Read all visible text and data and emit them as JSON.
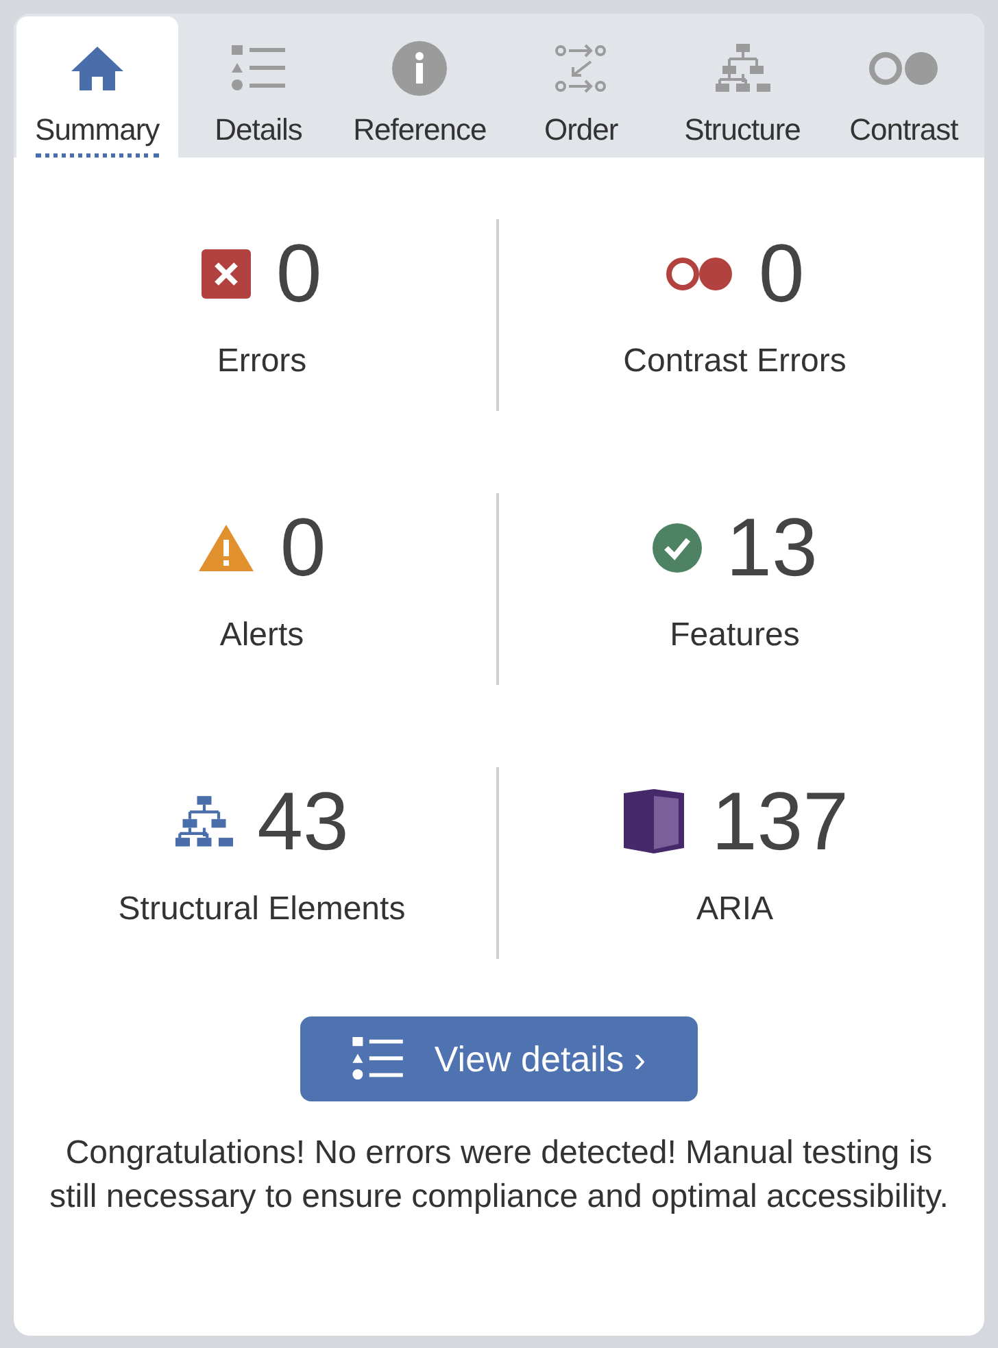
{
  "tabs": [
    {
      "label": "Summary",
      "kind": "home",
      "selected": true
    },
    {
      "label": "Details",
      "kind": "list",
      "selected": false
    },
    {
      "label": "Reference",
      "kind": "info",
      "selected": false
    },
    {
      "label": "Order",
      "kind": "order",
      "selected": false
    },
    {
      "label": "Structure",
      "kind": "tree",
      "selected": false
    },
    {
      "label": "Contrast",
      "kind": "contrast",
      "selected": false
    }
  ],
  "stats": [
    {
      "kind": "errors",
      "count": "0",
      "label": "Errors"
    },
    {
      "kind": "contrast",
      "count": "0",
      "label": "Contrast Errors"
    },
    {
      "kind": "alerts",
      "count": "0",
      "label": "Alerts"
    },
    {
      "kind": "features",
      "count": "13",
      "label": "Features"
    },
    {
      "kind": "structure",
      "count": "43",
      "label": "Structural Elements"
    },
    {
      "kind": "aria",
      "count": "137",
      "label": "ARIA"
    }
  ],
  "button": "View details ›",
  "message": "Congratulations! No errors were detected! Manual testing is still necessary to ensure compliance and optimal accessibility."
}
